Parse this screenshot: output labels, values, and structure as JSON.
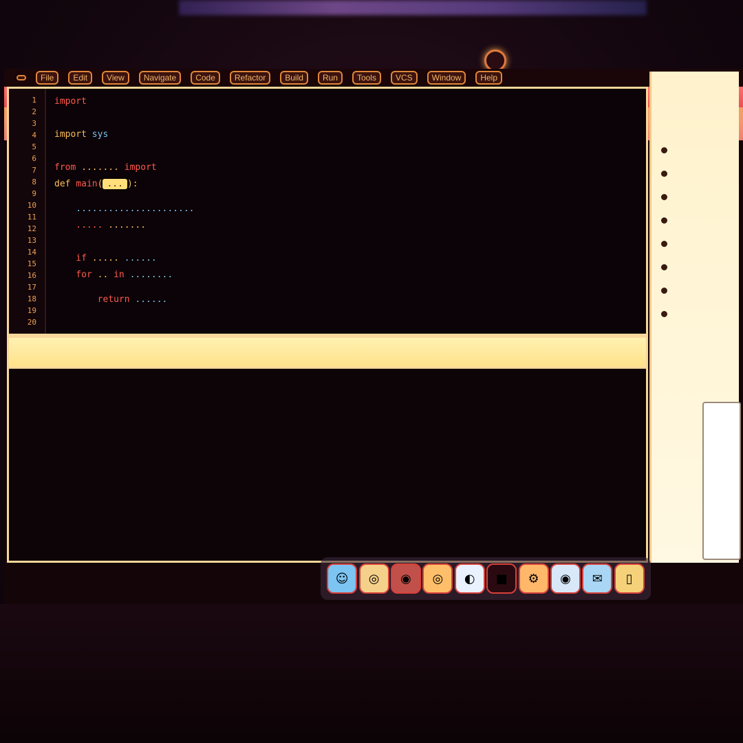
{
  "menubar": {
    "items": [
      "",
      "File",
      "Edit",
      "View",
      "Navigate",
      "Code",
      "Refactor",
      "Build",
      "Run",
      "Tools",
      "VCS",
      "Window",
      "Help"
    ]
  },
  "titlebar": {
    "title": ""
  },
  "toolbar": {
    "buttons": [
      "◀",
      "▶",
      "▲",
      "●",
      "◆",
      "■",
      "▶",
      "⟳"
    ],
    "tabs": [
      "",
      "",
      "",
      "",
      "",
      "",
      "",
      ""
    ]
  },
  "editor": {
    "line_numbers": [
      "1",
      "2",
      "3",
      "4",
      "5",
      "6",
      "7",
      "8",
      "9",
      "10",
      "11",
      "12",
      "13",
      "14",
      "15",
      "16",
      "17",
      "18",
      "19",
      "20"
    ],
    "lines": [
      {
        "parts": [
          {
            "c": "kw",
            "t": "import"
          }
        ]
      },
      {
        "parts": [
          {
            "c": "tx",
            "t": "import "
          },
          {
            "c": "st",
            "t": "sys"
          }
        ]
      },
      {
        "parts": [
          {
            "c": "kw",
            "t": "from"
          },
          {
            "c": "tx",
            "t": " ....... "
          },
          {
            "c": "kw",
            "t": "import"
          }
        ]
      },
      {
        "parts": [
          {
            "c": "tx",
            "t": "def "
          },
          {
            "c": "kw",
            "t": "main"
          },
          {
            "c": "tx",
            "t": "("
          },
          {
            "c": "hl",
            "t": "..."
          },
          {
            "c": "tx",
            "t": "):"
          }
        ]
      },
      {
        "parts": [
          {
            "c": "st",
            "t": "    ......................"
          }
        ]
      },
      {
        "parts": [
          {
            "c": "kw",
            "t": "    ....."
          },
          {
            "c": "tx",
            "t": " ......."
          }
        ]
      },
      {
        "parts": [
          {
            "c": "kw",
            "t": "    if"
          },
          {
            "c": "tx",
            "t": " ..... "
          },
          {
            "c": "st",
            "t": "......"
          }
        ]
      },
      {
        "parts": [
          {
            "c": "kw",
            "t": "    for"
          },
          {
            "c": "tx",
            "t": " .. "
          },
          {
            "c": "kw",
            "t": "in"
          },
          {
            "c": "st",
            "t": " ........"
          }
        ]
      },
      {
        "parts": [
          {
            "c": "kw",
            "t": "        return"
          },
          {
            "c": "st",
            "t": " ......"
          }
        ]
      }
    ]
  },
  "console": {
    "header": "",
    "lines": [
      {
        "prompt": "",
        "text": ""
      },
      {
        "prompt": "",
        "text": ""
      },
      {
        "prompt": "",
        "text": ""
      },
      {
        "prompt": "",
        "text": ""
      },
      {
        "prompt": "",
        "text": ""
      },
      {
        "prompt": "",
        "text": ""
      },
      {
        "prompt": "",
        "text": ""
      },
      {
        "prompt": "",
        "text": ""
      }
    ]
  },
  "right_panel": {
    "rows": [
      "",
      "",
      "",
      "",
      "",
      "",
      "",
      ""
    ]
  },
  "dock": {
    "icons": [
      {
        "name": "finder-icon",
        "glyph": "☺",
        "bg": "#7cc4f2"
      },
      {
        "name": "launchpad-icon",
        "glyph": "◎",
        "bg": "#f5d08a"
      },
      {
        "name": "app-icon",
        "glyph": "◉",
        "bg": "#c2504a"
      },
      {
        "name": "safari-icon",
        "glyph": "◎",
        "bg": "#ffbf6a"
      },
      {
        "name": "chrome-icon",
        "glyph": "◐",
        "bg": "#eaf2ff"
      },
      {
        "name": "terminal-icon",
        "glyph": "■",
        "bg": "#2a0a10"
      },
      {
        "name": "settings-icon",
        "glyph": "⚙",
        "bg": "#ffb86a"
      },
      {
        "name": "browser-icon",
        "glyph": "◉",
        "bg": "#d8e8f8"
      },
      {
        "name": "mail-icon",
        "glyph": "✉",
        "bg": "#a9d6f4"
      },
      {
        "name": "trash-icon",
        "glyph": "▯",
        "bg": "#f5d27a"
      }
    ]
  }
}
